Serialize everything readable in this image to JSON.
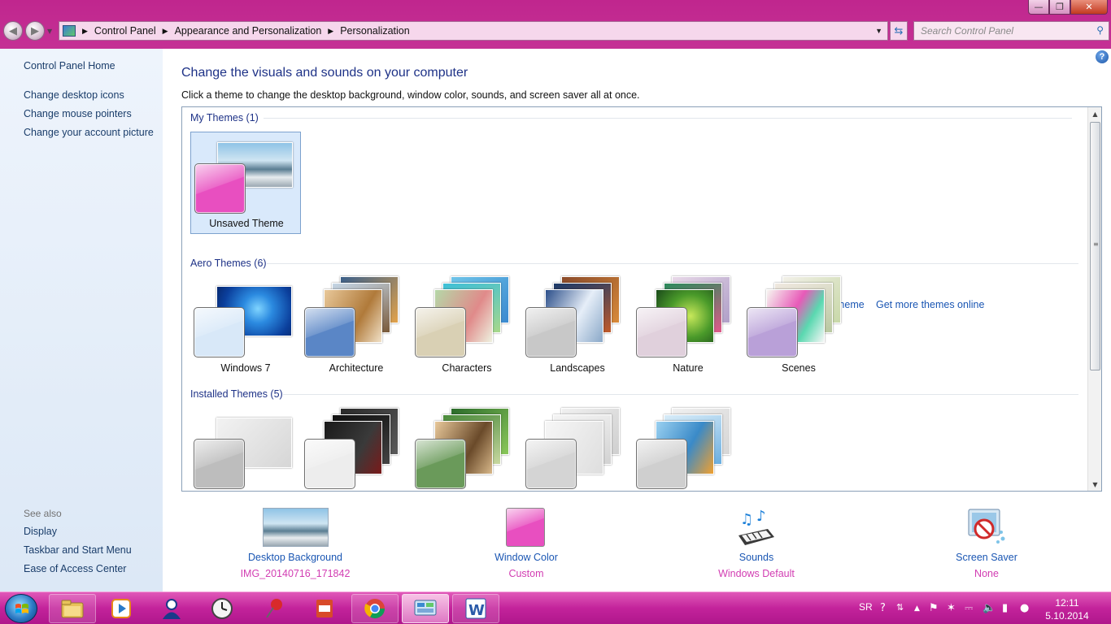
{
  "window": {
    "min_glyph": "—",
    "max_glyph": "❐",
    "close_glyph": "✕"
  },
  "address": {
    "breadcrumbs": [
      "Control Panel",
      "Appearance and Personalization",
      "Personalization"
    ],
    "search_placeholder": "Search Control Panel"
  },
  "sidebar": {
    "home": "Control Panel Home",
    "links": [
      "Change desktop icons",
      "Change mouse pointers",
      "Change your account picture"
    ],
    "see_also_label": "See also",
    "see_also": [
      "Display",
      "Taskbar and Start Menu",
      "Ease of Access Center"
    ]
  },
  "main": {
    "heading": "Change the visuals and sounds on your computer",
    "subtitle": "Click a theme to change the desktop background, window color, sounds, and screen saver all at once.",
    "help_glyph": "?"
  },
  "sections": {
    "my_themes": "My Themes (1)",
    "aero_themes": "Aero Themes (6)",
    "installed_themes": "Installed Themes (5)"
  },
  "themes": {
    "my": [
      {
        "label": "Unsaved Theme",
        "color": "#e84fc0"
      }
    ],
    "aero": [
      {
        "label": "Windows 7",
        "color": "#d8e8f8"
      },
      {
        "label": "Architecture",
        "color": "#5a86c6"
      },
      {
        "label": "Characters",
        "color": "#d9d0b4"
      },
      {
        "label": "Landscapes",
        "color": "#c8c8c8"
      },
      {
        "label": "Nature",
        "color": "#e0d0dc"
      },
      {
        "label": "Scenes",
        "color": "#b9a0d8"
      }
    ],
    "installed_colors": [
      "#bdbdbd",
      "#ededed",
      "#6a9a5a",
      "#d4d4d4",
      "#cfcfcf"
    ]
  },
  "actions": {
    "save": "Save theme",
    "more": "Get more themes online"
  },
  "bottom": {
    "desktop_background": {
      "title": "Desktop Background",
      "value": "IMG_20140716_171842"
    },
    "window_color": {
      "title": "Window Color",
      "value": "Custom"
    },
    "sounds": {
      "title": "Sounds",
      "value": "Windows Default"
    },
    "screen_saver": {
      "title": "Screen Saver",
      "value": "None"
    }
  },
  "taskbar": {
    "language": "SR",
    "time": "12:11",
    "date": "5.10.2014",
    "accent": "#c3239b"
  }
}
